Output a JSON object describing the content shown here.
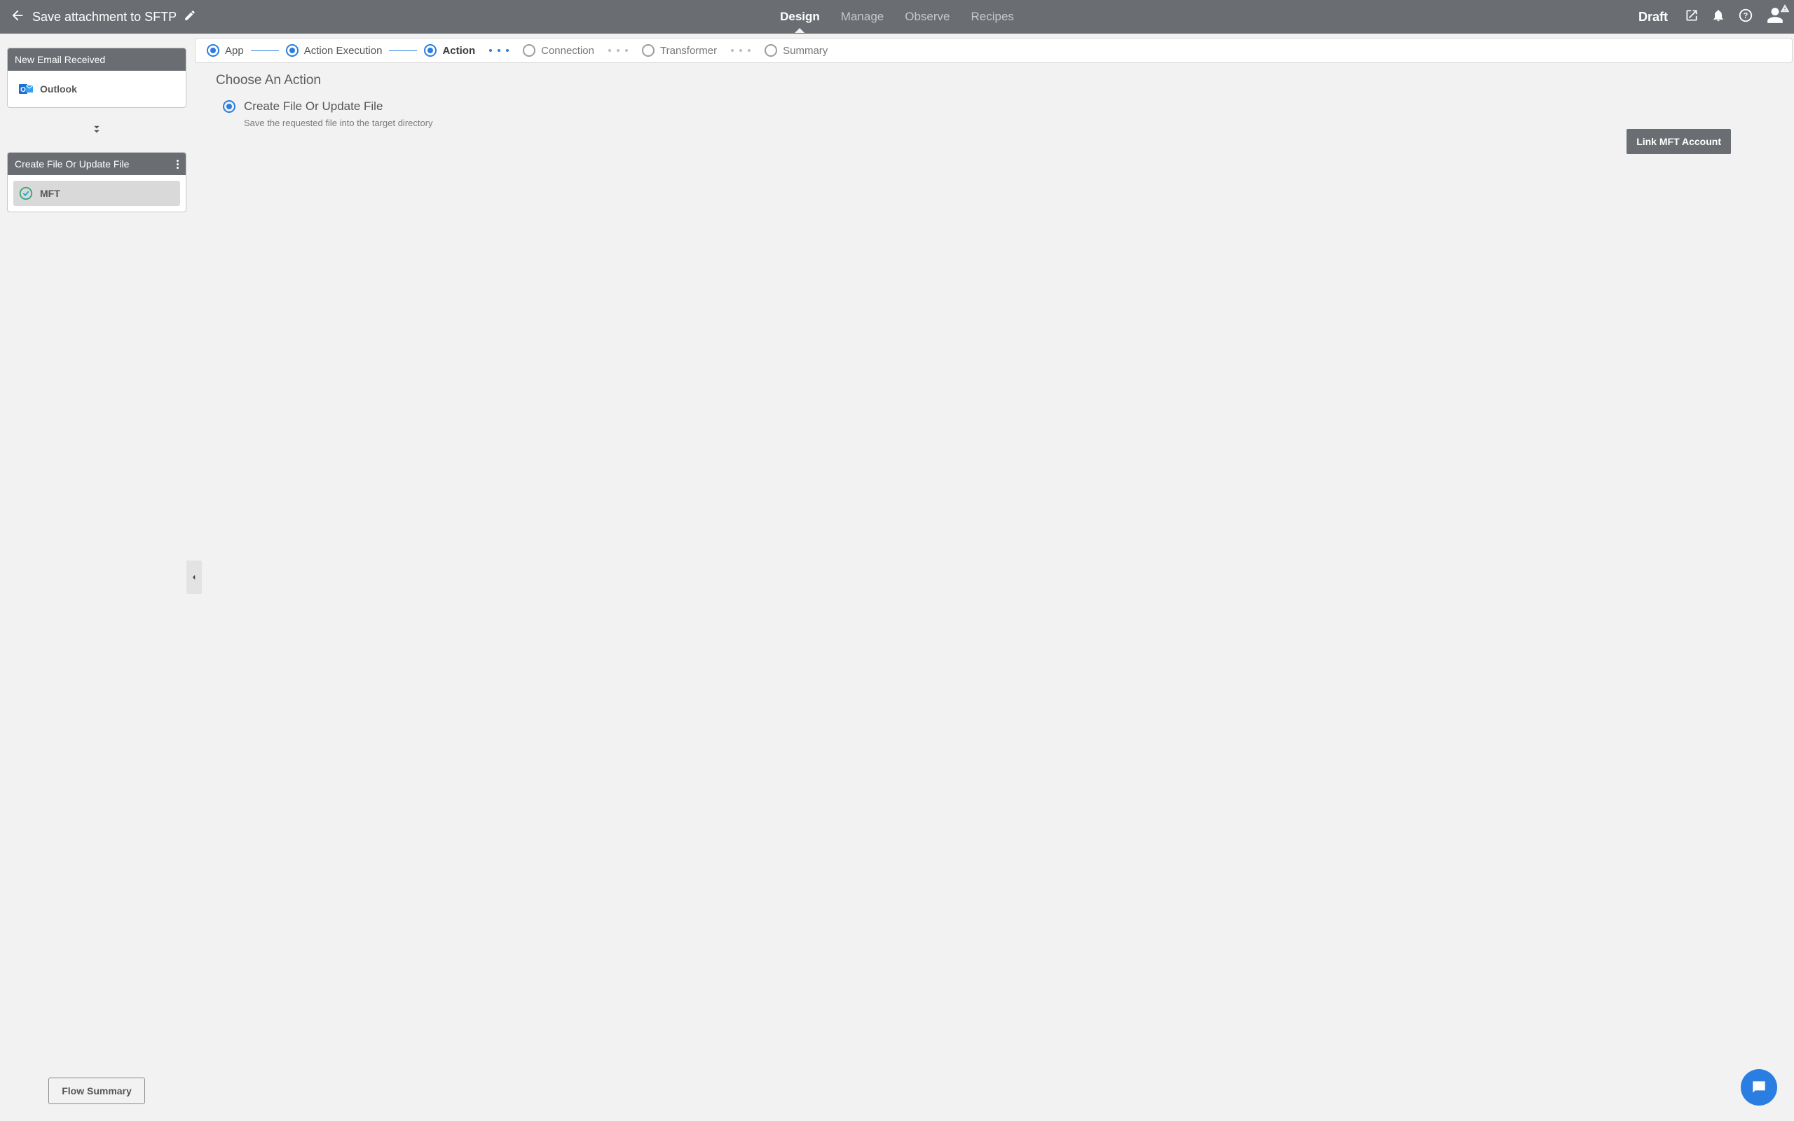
{
  "header": {
    "title": "Save attachment to SFTP",
    "status": "Draft",
    "tabs": [
      {
        "label": "Design",
        "active": true
      },
      {
        "label": "Manage",
        "active": false
      },
      {
        "label": "Observe",
        "active": false
      },
      {
        "label": "Recipes",
        "active": false
      }
    ]
  },
  "sidebar": {
    "nodes": [
      {
        "title": "New Email Received",
        "item_label": "Outlook",
        "kebab": false,
        "selected": false
      },
      {
        "title": "Create File Or Update File",
        "item_label": "MFT",
        "kebab": true,
        "selected": true
      }
    ],
    "flow_summary_label": "Flow Summary"
  },
  "stepper": {
    "steps": [
      {
        "label": "App",
        "state": "done"
      },
      {
        "label": "Action Execution",
        "state": "done"
      },
      {
        "label": "Action",
        "state": "current"
      },
      {
        "label": "Connection",
        "state": "pending"
      },
      {
        "label": "Transformer",
        "state": "pending"
      },
      {
        "label": "Summary",
        "state": "pending"
      }
    ]
  },
  "main": {
    "heading": "Choose An Action",
    "option": {
      "title": "Create File Or Update File",
      "description": "Save the requested file into the target directory"
    },
    "link_button": "Link MFT Account"
  }
}
